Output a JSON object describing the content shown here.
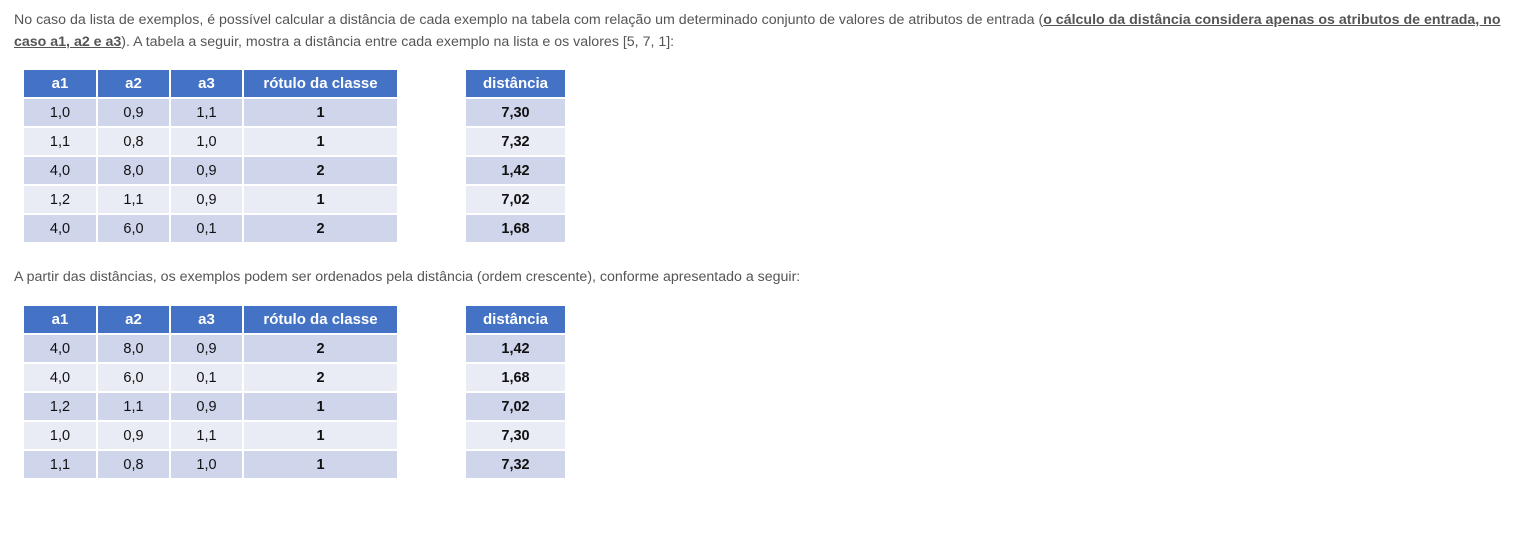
{
  "intro": {
    "before": "No caso da lista de exemplos, é possível calcular a distância de cada exemplo na tabela com relação um determinado conjunto de valores de atributos de entrada (",
    "emphasis": "o cálculo da distância considera apenas os atributos de entrada, no caso a1, a2 e a3",
    "after": "). A tabela a seguir, mostra a distância entre cada exemplo na lista e os valores [5, 7, 1]:"
  },
  "middle_text": "A partir das distâncias, os exemplos podem ser ordenados pela distância (ordem crescente), conforme apresentado a seguir:",
  "headers": {
    "a1": "a1",
    "a2": "a2",
    "a3": "a3",
    "label": "rótulo da classe",
    "distance": "distância"
  },
  "table1": {
    "rows": [
      {
        "a1": "1,0",
        "a2": "0,9",
        "a3": "1,1",
        "label": "1",
        "distance": "7,30"
      },
      {
        "a1": "1,1",
        "a2": "0,8",
        "a3": "1,0",
        "label": "1",
        "distance": "7,32"
      },
      {
        "a1": "4,0",
        "a2": "8,0",
        "a3": "0,9",
        "label": "2",
        "distance": "1,42"
      },
      {
        "a1": "1,2",
        "a2": "1,1",
        "a3": "0,9",
        "label": "1",
        "distance": "7,02"
      },
      {
        "a1": "4,0",
        "a2": "6,0",
        "a3": "0,1",
        "label": "2",
        "distance": "1,68"
      }
    ]
  },
  "table2": {
    "rows": [
      {
        "a1": "4,0",
        "a2": "8,0",
        "a3": "0,9",
        "label": "2",
        "distance": "1,42"
      },
      {
        "a1": "4,0",
        "a2": "6,0",
        "a3": "0,1",
        "label": "2",
        "distance": "1,68"
      },
      {
        "a1": "1,2",
        "a2": "1,1",
        "a3": "0,9",
        "label": "1",
        "distance": "7,02"
      },
      {
        "a1": "1,0",
        "a2": "0,9",
        "a3": "1,1",
        "label": "1",
        "distance": "7,30"
      },
      {
        "a1": "1,1",
        "a2": "0,8",
        "a3": "1,0",
        "label": "1",
        "distance": "7,32"
      }
    ]
  },
  "colors": {
    "header_bg": "#4472c4",
    "row_dark": "#cfd5ea",
    "row_light": "#e9ebf5",
    "text": "#555555"
  }
}
